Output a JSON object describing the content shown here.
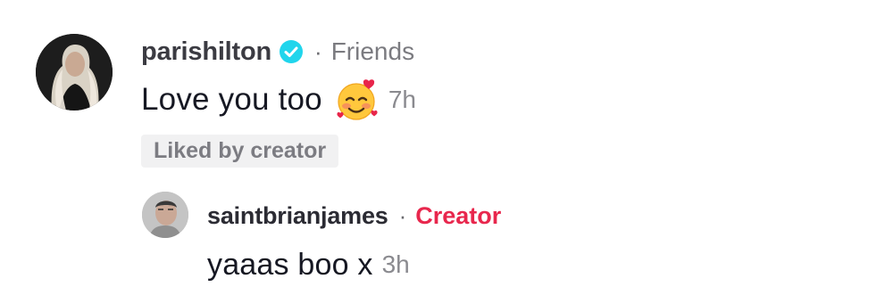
{
  "comment": {
    "username": "parishilton",
    "relation": "Friends",
    "text": "Love you too",
    "emoji": "smiling-face-with-hearts-icon",
    "time": "7h",
    "liked_badge": "Liked by creator"
  },
  "reply": {
    "username": "saintbrianjames",
    "badge": "Creator",
    "text": "yaaas boo x",
    "time": "3h"
  },
  "colors": {
    "verified": "#20d5ec",
    "creator": "#e8274d",
    "muted": "#8a8a8f"
  }
}
